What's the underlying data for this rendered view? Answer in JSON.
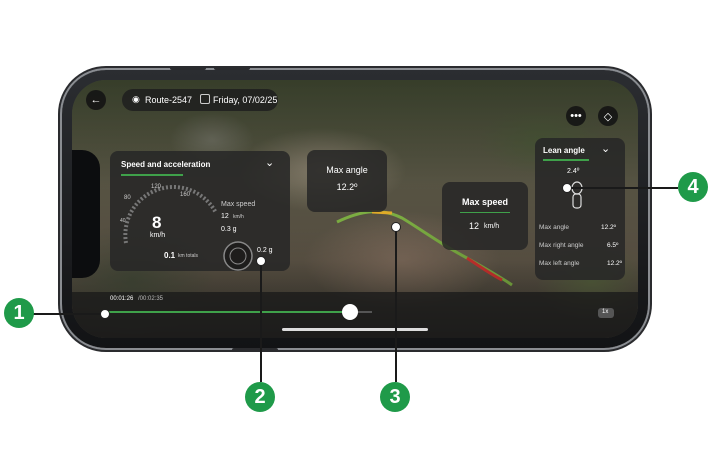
{
  "header": {
    "back_icon": "back-arrow-icon",
    "route_icon": "route-icon",
    "route_name": "Route-2547",
    "date_icon": "calendar-icon",
    "date": "Friday, 07/02/25",
    "more_icon": "more-dots-icon",
    "layers_icon": "layers-icon"
  },
  "speed_panel": {
    "title": "Speed and acceleration",
    "speed_value": "8",
    "speed_unit": "km/h",
    "gauge_ticks": [
      "40",
      "80",
      "120",
      "160"
    ],
    "distance_value": "0.1",
    "distance_unit": "km totals",
    "max_speed_label": "Max speed",
    "max_speed_value": "12",
    "max_speed_unit": "km/h",
    "accel_value": "0.3 g",
    "current_g": "0.2 g"
  },
  "max_angle_popup": {
    "label": "Max angle",
    "value": "12.2º"
  },
  "max_speed_popup": {
    "label": "Max speed",
    "value": "12",
    "unit": "km/h"
  },
  "lean_panel": {
    "title": "Lean angle",
    "current": "2.4º",
    "rows": [
      {
        "label": "Max angle",
        "value": "12.2º"
      },
      {
        "label": "Max right angle",
        "value": "6.5º"
      },
      {
        "label": "Max left angle",
        "value": "12.2º"
      }
    ]
  },
  "timeline": {
    "elapsed": "00:01:26",
    "total": "/00:02:35",
    "progress": 0.92,
    "speed_button": "1x"
  },
  "callouts": [
    "1",
    "2",
    "3",
    "4"
  ],
  "colors": {
    "accent": "#3fa14a",
    "badge": "#1f9a49"
  }
}
